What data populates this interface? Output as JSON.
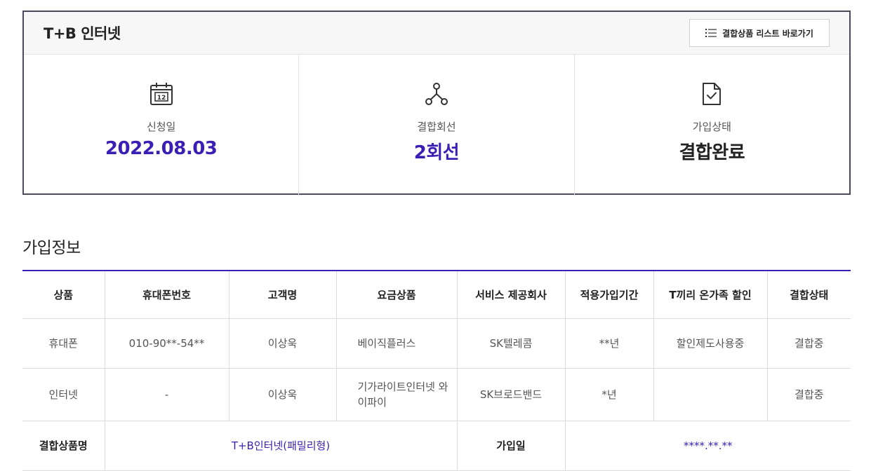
{
  "summary": {
    "title": "T+B 인터넷",
    "list_button_label": "결합상품 리스트 바로가기",
    "stats": [
      {
        "icon": "calendar-icon",
        "label": "신청일",
        "value": "2022.08.03"
      },
      {
        "icon": "network-icon",
        "label": "결합회선",
        "value": "2회선"
      },
      {
        "icon": "document-check-icon",
        "label": "가입상태",
        "value": "결합완료"
      }
    ]
  },
  "join_info": {
    "title": "가입정보",
    "headers": [
      "상품",
      "휴대폰번호",
      "고객명",
      "요금상품",
      "서비스 제공회사",
      "적용가입기간",
      "T끼리 온가족 할인",
      "결합상태"
    ],
    "rows": [
      [
        "휴대폰",
        "010-90**-54**",
        "이상욱",
        "베이직플러스",
        "SK텔레콤",
        "**년",
        "할인제도사용중",
        "결합중"
      ],
      [
        "인터넷",
        "-",
        "이상욱",
        "기가라이트인터넷 와이파이",
        "SK브로드밴드",
        "*년",
        "",
        "결합중"
      ]
    ],
    "footer": {
      "product_name_label": "결합상품명",
      "product_name_value": "T+B인터넷(패밀리형)",
      "join_date_label": "가입일",
      "join_date_value": "****.**.**"
    }
  },
  "colors": {
    "accent": "#3b1fb5",
    "border": "#4a4a5a"
  }
}
